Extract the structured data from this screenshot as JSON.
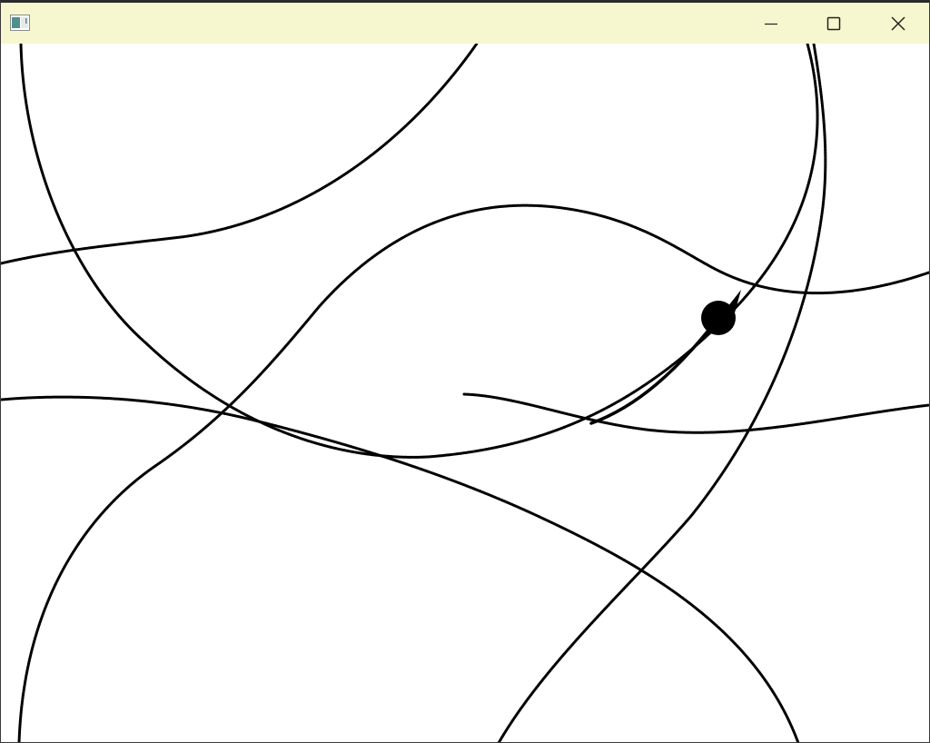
{
  "window": {
    "title": "",
    "app_icon": "app-window-icon",
    "controls": {
      "minimize_icon": "minimize-icon",
      "maximize_icon": "maximize-icon",
      "close_icon": "close-icon"
    }
  },
  "colors": {
    "titlebar_background": "#f7f7cf",
    "canvas_background": "#ffffff",
    "stroke": "#000000"
  },
  "canvas": {
    "description_items": {
      "trail_count": 6,
      "has_turtle_cursor": true
    }
  }
}
